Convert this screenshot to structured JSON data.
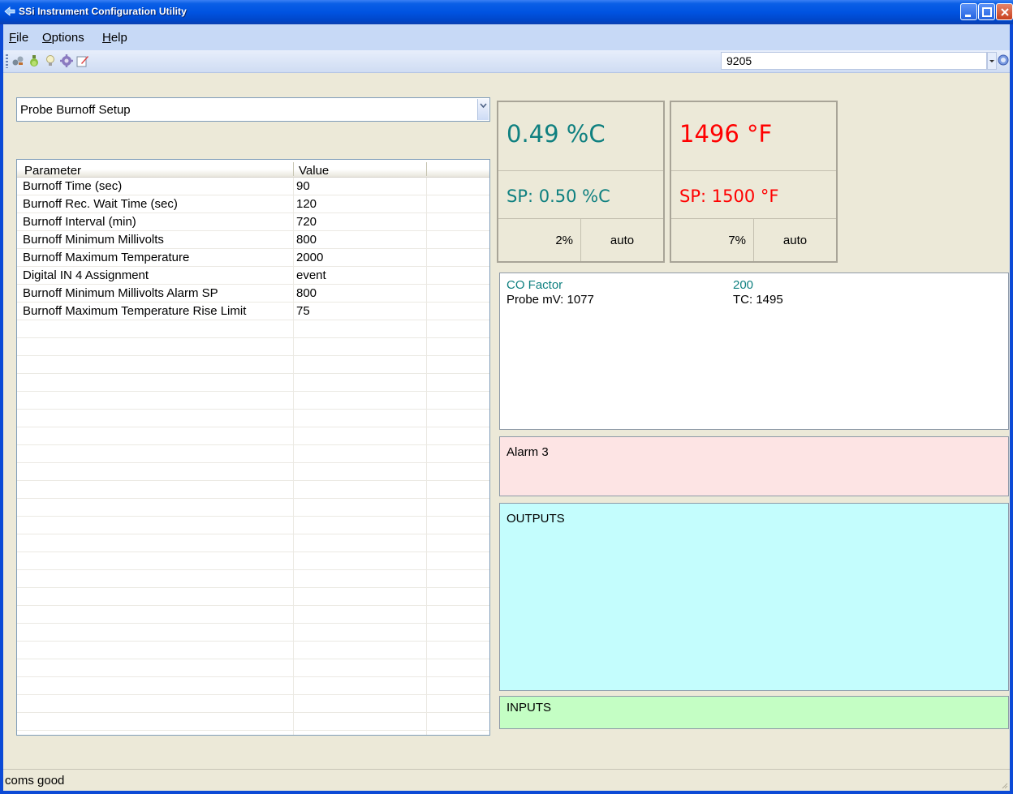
{
  "window": {
    "title": "SSi Instrument Configuration Utility"
  },
  "menubar": {
    "items": [
      {
        "label": "File",
        "accel": "F",
        "rest": "ile"
      },
      {
        "label": "Options",
        "accel": "O",
        "rest": "ptions"
      },
      {
        "label": "Help",
        "accel": "H",
        "rest": "elp"
      }
    ]
  },
  "toolbar": {
    "icons": [
      "connect-icon",
      "bottle-icon",
      "lightbulb-icon",
      "gear-icon",
      "edit-icon"
    ],
    "instrument": "9205",
    "help_icon": "help-icon"
  },
  "menu_select": {
    "value": "Probe Burnoff Setup"
  },
  "grid": {
    "headers": {
      "parameter": "Parameter",
      "value": "Value"
    },
    "rows": [
      {
        "parameter": "Burnoff Time (sec)",
        "value": "90"
      },
      {
        "parameter": "Burnoff Rec. Wait Time (sec)",
        "value": "120"
      },
      {
        "parameter": "Burnoff Interval (min)",
        "value": "720"
      },
      {
        "parameter": "Burnoff Minimum Millivolts",
        "value": "800"
      },
      {
        "parameter": "Burnoff Maximum Temperature",
        "value": "2000"
      },
      {
        "parameter": "Digital IN 4 Assignment",
        "value": "event"
      },
      {
        "parameter": "Burnoff Minimum Millivolts Alarm SP",
        "value": "800"
      },
      {
        "parameter": "Burnoff Maximum Temperature Rise Limit",
        "value": "75"
      }
    ]
  },
  "gauges": [
    {
      "value": "0.49 %C",
      "setpoint": "SP: 0.50 %C",
      "output": "2%",
      "mode": "auto",
      "color": "#0f8080"
    },
    {
      "value": "1496 °F",
      "setpoint": "SP: 1500 °F",
      "output": "7%",
      "mode": "auto",
      "color": "#ff0000"
    }
  ],
  "co_factor": {
    "label": "CO Factor",
    "value": "200",
    "probe_mv": "Probe mV: 1077",
    "tc": "TC: 1495",
    "accent": "#0f8080"
  },
  "alarm": {
    "title": "Alarm 3",
    "color": "#fde4e4"
  },
  "outputs": {
    "title": "OUTPUTS",
    "color": "#c4fdfd"
  },
  "inputs": {
    "title": "INPUTS",
    "color": "#c4fec4"
  },
  "status": {
    "text": "coms good"
  }
}
